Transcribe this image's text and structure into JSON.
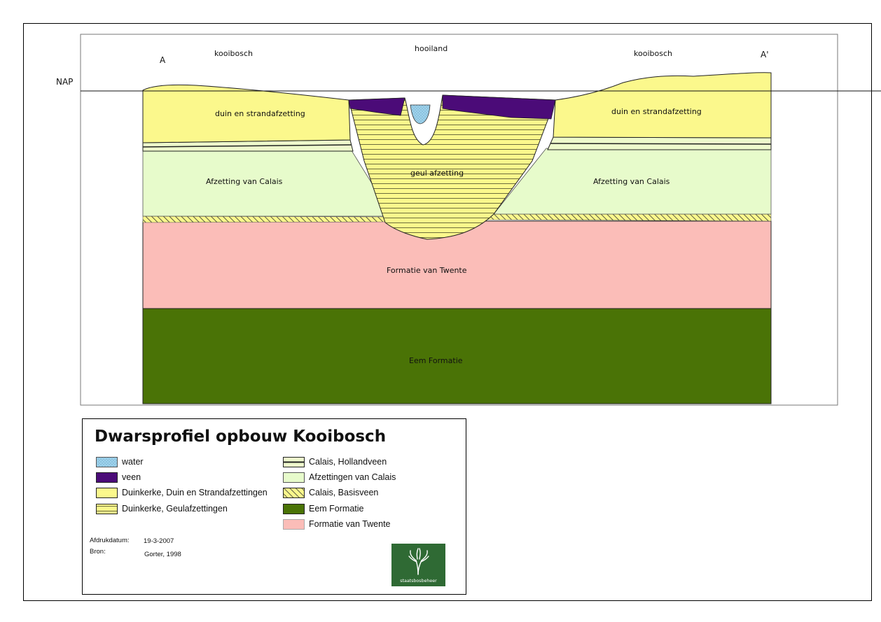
{
  "section": {
    "point_a": "A",
    "point_a_prime": "A'",
    "nap": "NAP",
    "place_left": "kooibosch",
    "place_center": "hooiland",
    "place_right": "kooibosch",
    "layer_duin_left": "duin en strandafzetting",
    "layer_duin_right": "duin en strandafzetting",
    "layer_geul": "geul afzetting",
    "layer_calais_left": "Afzetting van Calais",
    "layer_calais_right": "Afzetting van Calais",
    "layer_twente": "Formatie van Twente",
    "layer_eem": "Eem Formatie"
  },
  "legend": {
    "title": "Dwarsprofiel opbouw Kooibosch",
    "items_left": [
      {
        "label": "water",
        "swatch": "water"
      },
      {
        "label": "veen",
        "swatch": "veen"
      },
      {
        "label": "Duinkerke, Duin en Strandafzettingen",
        "swatch": "duin"
      },
      {
        "label": "Duinkerke, Geulafzettingen",
        "swatch": "geul"
      }
    ],
    "items_right": [
      {
        "label": "Calais, Hollandveen",
        "swatch": "hollandveen"
      },
      {
        "label": "Afzettingen van Calais",
        "swatch": "calais"
      },
      {
        "label": "Calais, Basisveen",
        "swatch": "basisveen"
      },
      {
        "label": "Eem Formatie",
        "swatch": "eem"
      },
      {
        "label": "Formatie van Twente",
        "swatch": "twente"
      }
    ],
    "print_date_label": "Afdrukdatum:",
    "print_date_value": "19-3-2007",
    "source_label": "Bron:",
    "source_value": "Gorter, 1998",
    "logo_text": "staatsbosbeheer"
  },
  "colors": {
    "water": "#9fd3ec",
    "veen": "#4b0b78",
    "duin": "#fbf88c",
    "geul": "#fbf88c",
    "calais": "#e7fbcb",
    "twente": "#fbbdb8",
    "eem": "#4a7306",
    "logo": "#2f6a34"
  }
}
